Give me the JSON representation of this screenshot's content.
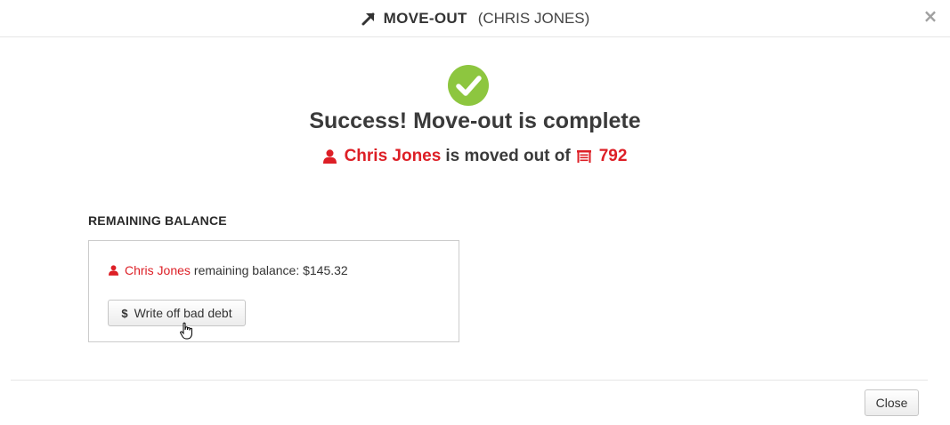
{
  "header": {
    "title": "MOVE-OUT",
    "subtitle": "(CHRIS JONES)",
    "close_symbol": "×",
    "arrow_icon": "arrow-up-right-icon"
  },
  "success": {
    "icon": "check-circle-icon",
    "icon_color": "#8dc63f",
    "title": "Success! Move-out is complete",
    "tenant_name": "Chris Jones",
    "moved_text": "is moved out of",
    "unit": "792",
    "accent_color": "#dd1f26"
  },
  "balance": {
    "section_title": "REMAINING BALANCE",
    "tenant_name": "Chris Jones",
    "label": "remaining balance: $145.32",
    "writeoff_icon": "$",
    "writeoff_label": "Write off bad debt"
  },
  "footer": {
    "close_label": "Close"
  }
}
